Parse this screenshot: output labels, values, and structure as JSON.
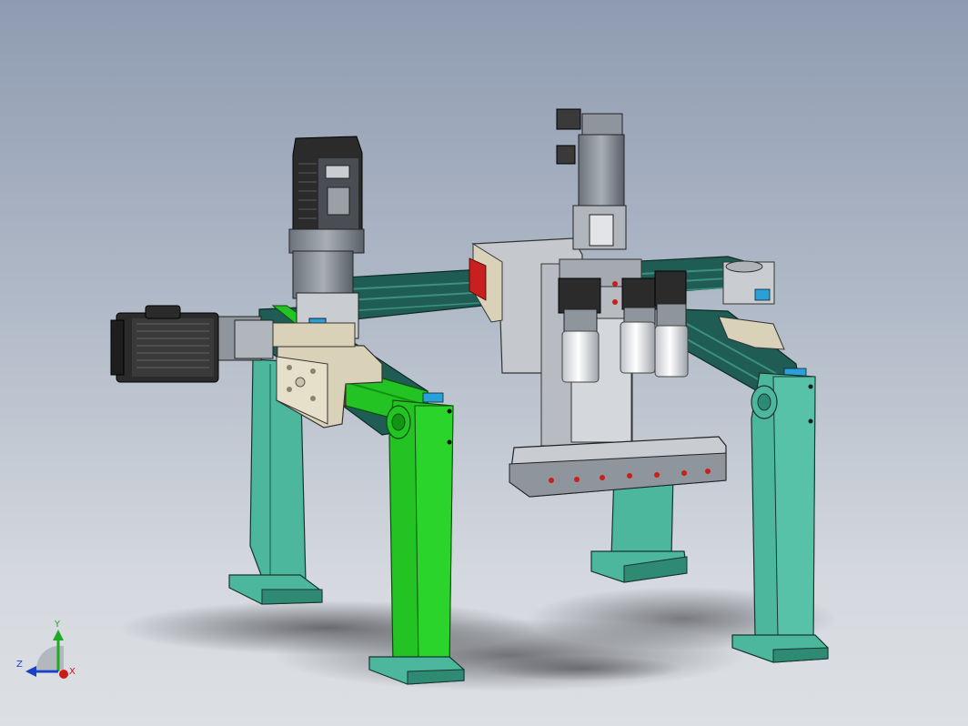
{
  "viewport": {
    "background_top": "#8f9bb1",
    "background_bottom": "#dcdfe3"
  },
  "model": {
    "colors": {
      "legs_teal": "#4db79d",
      "legs_teal_dark": "#2f8a73",
      "highlighted_leg_green": "#22c322",
      "highlighted_leg_green_dark": "#149414",
      "rail_dark_green": "#1f5d54",
      "motor_black": "#2b2b2b",
      "motor_gray": "#8f959d",
      "bracket_beige": "#d9d2b8",
      "accent_blue": "#2aa0d8",
      "accent_red": "#c81f1f"
    }
  },
  "triad": {
    "y_label": "Y",
    "z_label": "Z",
    "x_label": "X",
    "y_color": "#22a822",
    "z_color": "#1a3fc8",
    "x_color": "#d01818"
  }
}
